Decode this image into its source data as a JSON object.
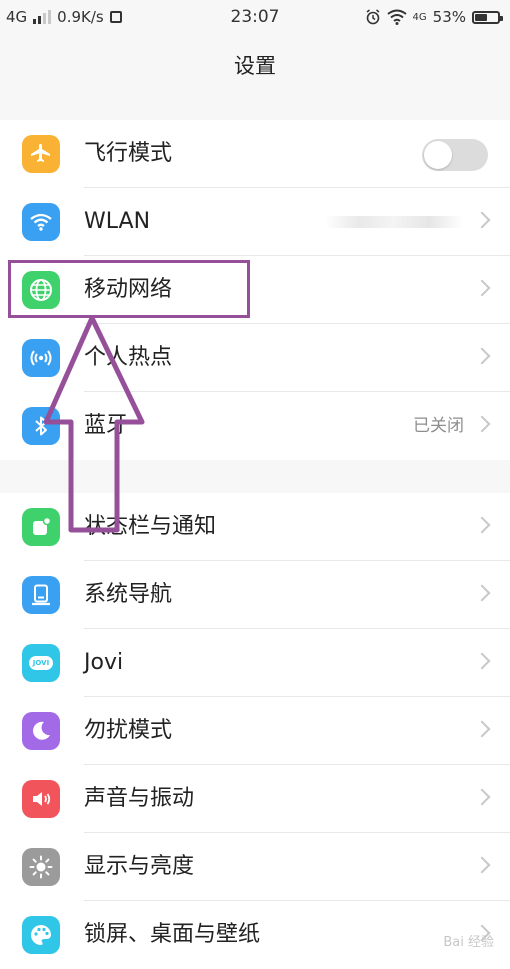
{
  "status_bar": {
    "network": "4G",
    "speed": "0.9K/s",
    "time": "23:07",
    "network_right": "4G",
    "battery_percent": "53%",
    "battery_level": 0.53
  },
  "header": {
    "title": "设置"
  },
  "group1": [
    {
      "label": "飞行模式",
      "icon": "airplane-icon",
      "color": "#f9b233",
      "control": "toggle",
      "toggle_on": false
    },
    {
      "label": "WLAN",
      "icon": "wifi-icon",
      "color": "#3aa0f2",
      "value": ""
    },
    {
      "label": "移动网络",
      "icon": "globe-icon",
      "color": "#3fd26c",
      "value": ""
    },
    {
      "label": "个人热点",
      "icon": "hotspot-icon",
      "color": "#3aa0f2",
      "value": ""
    },
    {
      "label": "蓝牙",
      "icon": "bluetooth-icon",
      "color": "#3aa0f2",
      "value": "已关闭"
    }
  ],
  "group2": [
    {
      "label": "状态栏与通知",
      "icon": "notification-icon",
      "color": "#3fd26c"
    },
    {
      "label": "系统导航",
      "icon": "navigation-icon",
      "color": "#3aa0f2"
    },
    {
      "label": "Jovi",
      "icon": "jovi-icon",
      "color": "#2fc6e8",
      "icon_text": "JOVI"
    },
    {
      "label": "勿扰模式",
      "icon": "moon-icon",
      "color": "#a36ae8"
    },
    {
      "label": "声音与振动",
      "icon": "speaker-icon",
      "color": "#f2545b"
    },
    {
      "label": "显示与亮度",
      "icon": "brightness-icon",
      "color": "#9b9b9b"
    },
    {
      "label": "锁屏、桌面与壁纸",
      "icon": "palette-icon",
      "color": "#2fc6e8"
    }
  ],
  "annotation": {
    "color": "#96509a"
  },
  "watermark": "Bai 经验"
}
